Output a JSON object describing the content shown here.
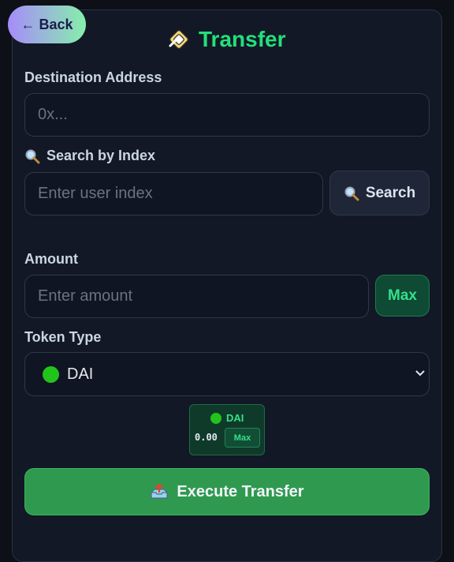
{
  "header": {
    "back_label": "← Back",
    "title": "Transfer",
    "title_icon": "transfer-logo-icon",
    "accent_color": "#22e07a"
  },
  "destination": {
    "label": "Destination Address",
    "placeholder": "0x..."
  },
  "search": {
    "label": "Search by Index",
    "label_icon": "magnifier-icon",
    "placeholder": "Enter user index",
    "button_label": "Search"
  },
  "amount": {
    "label": "Amount",
    "placeholder": "Enter amount",
    "max_label": "Max"
  },
  "token": {
    "label": "Token Type",
    "selected": "DAI",
    "dot_color": "#22c31a"
  },
  "token_card": {
    "symbol": "DAI",
    "balance": "0.00",
    "max_label": "Max"
  },
  "execute": {
    "label": "Execute Transfer",
    "icon": "outbox-tray-icon",
    "color": "#2f9a4f"
  }
}
